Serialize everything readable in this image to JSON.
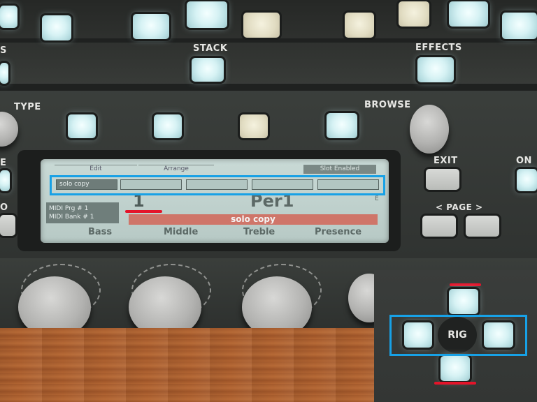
{
  "panel": {
    "stack_label": "STACK",
    "effects_label": "EFFECTS",
    "type_label": "TYPE",
    "browse_label": "BROWSE",
    "exit_label": "EXIT",
    "page_label": "< PAGE >",
    "left_edge_labels": [
      "S",
      "E",
      "O"
    ],
    "right_edge_label": "ON"
  },
  "lcd": {
    "tabs": [
      "Edit",
      "Arrange",
      "Slot Enabled"
    ],
    "slots": [
      "solo copy",
      "",
      "",
      "",
      ""
    ],
    "midi_program": "MIDI Prg  #  1",
    "midi_bank": "MIDI Bank  #  1",
    "performance_number": "1",
    "performance_name": "Per1",
    "edited_marker": "E",
    "slot_name": "solo copy",
    "soft_controls": [
      "Bass",
      "Middle",
      "Treble",
      "Presence"
    ]
  },
  "inset": {
    "rig_label": "RIG"
  },
  "colors": {
    "highlight": "#17a1e6",
    "marker": "#e4142a",
    "lcd_background": "#c9dad6",
    "lcd_accent": "#cf7569"
  }
}
